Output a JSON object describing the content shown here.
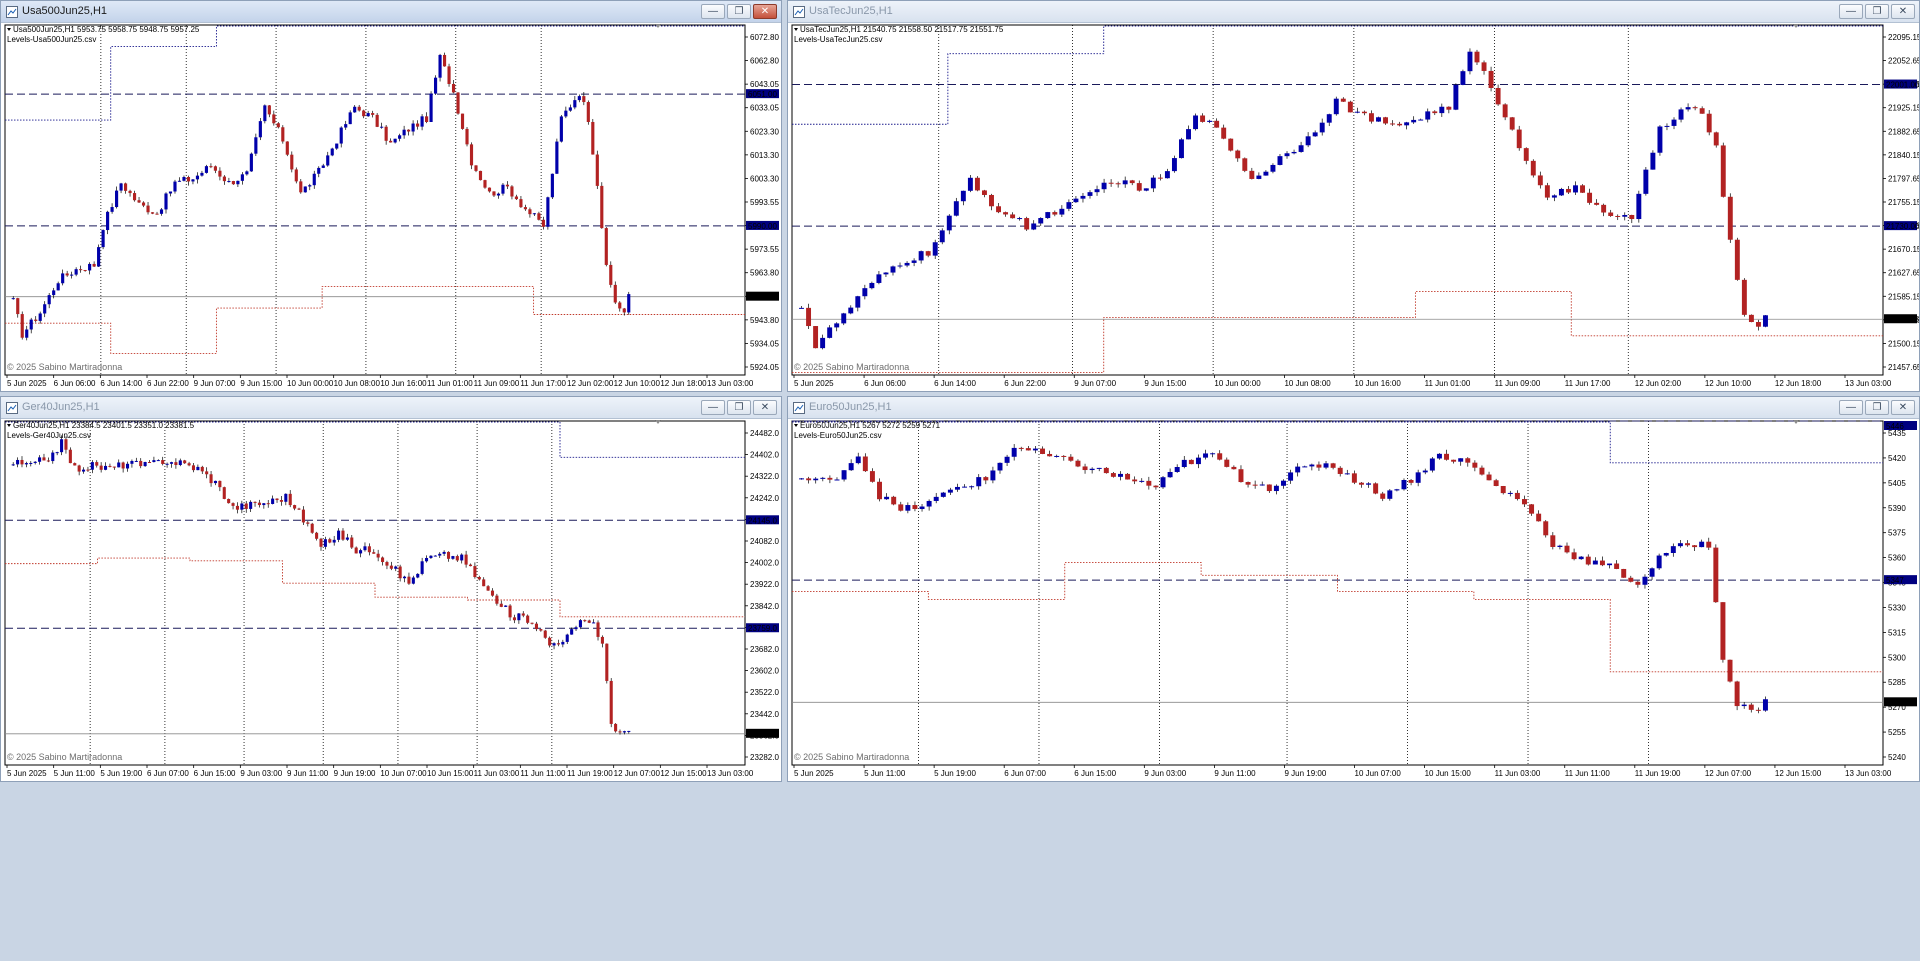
{
  "colors": {
    "bull": "#0000aa",
    "bear": "#b22222",
    "level_line": "#1a1a5a",
    "upper_band": "#1a1a8c",
    "lower_band": "#c0392b",
    "price_tag_bg": "#000000",
    "level_tag_bg": "#000080",
    "grid": "#000000"
  },
  "windows": [
    {
      "id": "us500",
      "active": true,
      "title": "Usa500Jun25,H1",
      "info_line": "Usa500Jun25,H1  5953.75 5958.75 5948.75 5957.25",
      "indicator": "Levels-Usa500Jun25.csv",
      "copyright": "© 2025 Sabino Martiradonna",
      "buttons": {
        "minimize": "—",
        "restore": "❐",
        "close": "✕"
      }
    },
    {
      "id": "ustec",
      "active": false,
      "title": "UsaTecJun25,H1",
      "info_line": "UsaTecJun25,H1  21540.75 21558.50 21517.75 21551.75",
      "indicator": "Levels-UsaTecJun25.csv",
      "copyright": "© 2025 Sabino Martiradonna",
      "buttons": {
        "minimize": "—",
        "restore": "❐",
        "close": "✕"
      }
    },
    {
      "id": "ger40",
      "active": false,
      "title": "Ger40Jun25,H1",
      "info_line": "Ger40Jun25,H1  23384.5 23401.5 23351.0 23381.5",
      "indicator": "Levels-Ger40Jun25.csv",
      "copyright": "© 2025 Sabino Martiradonna",
      "buttons": {
        "minimize": "—",
        "restore": "❐",
        "close": "✕"
      }
    },
    {
      "id": "euro50",
      "active": false,
      "title": "Euro50Jun25,H1",
      "info_line": "Euro50Jun25,H1  5267 5272 5259 5271",
      "indicator": "Levels-Euro50Jun25.csv",
      "copyright": "© 2025 Sabino Martiradonna",
      "buttons": {
        "minimize": "—",
        "restore": "❐",
        "close": "✕"
      }
    }
  ],
  "chart_data": [
    {
      "type": "candlestick",
      "title": "Usa500Jun25,H1",
      "ylim": [
        5921,
        6083
      ],
      "y_ticks": [
        "6072.80",
        "6062.80",
        "6043.05",
        "6033.05",
        "6023.30",
        "6013.30",
        "6003.30",
        "5993.55",
        "5983.55",
        "5973.55",
        "5963.80",
        "5953.80",
        "5943.80",
        "5934.05",
        "5924.05"
      ],
      "x_ticks": [
        "5 Jun 2025",
        "6 Jun 06:00",
        "6 Jun 14:00",
        "6 Jun 22:00",
        "9 Jun 07:00",
        "9 Jun 15:00",
        "10 Jun 00:00",
        "10 Jun 08:00",
        "10 Jun 16:00",
        "11 Jun 01:00",
        "11 Jun 09:00",
        "11 Jun 17:00",
        "12 Jun 02:00",
        "12 Jun 10:00",
        "12 Jun 18:00",
        "13 Jun 03:00"
      ],
      "day_separators": [
        "6 Jun",
        "9 Jun",
        "10 Jun",
        "11 Jun",
        "12 Jun",
        "13 Jun"
      ],
      "level_lines": [
        6051.0,
        5990.0
      ],
      "level_labels": [
        "6051.00",
        "5990.00"
      ],
      "current_price": 5957.25,
      "current_label": "5957.25",
      "upper_band": [
        6039,
        6073,
        6085,
        6085,
        6085,
        6085,
        6085
      ],
      "lower_band": [
        5945,
        5931,
        5952,
        5962,
        5962,
        5949,
        5949
      ],
      "waypoints": [
        [
          0,
          5955
        ],
        [
          2,
          5940
        ],
        [
          6,
          5950
        ],
        [
          10,
          5965
        ],
        [
          14,
          5970
        ],
        [
          18,
          5972
        ],
        [
          20,
          5990
        ],
        [
          24,
          6010
        ],
        [
          28,
          6000
        ],
        [
          32,
          5996
        ],
        [
          36,
          6010
        ],
        [
          40,
          6012
        ],
        [
          44,
          6018
        ],
        [
          48,
          6010
        ],
        [
          52,
          6014
        ],
        [
          56,
          6045
        ],
        [
          60,
          6030
        ],
        [
          64,
          6005
        ],
        [
          68,
          6015
        ],
        [
          72,
          6030
        ],
        [
          76,
          6045
        ],
        [
          80,
          6040
        ],
        [
          84,
          6028
        ],
        [
          88,
          6035
        ],
        [
          92,
          6040
        ],
        [
          95,
          6068
        ],
        [
          98,
          6052
        ],
        [
          102,
          6020
        ],
        [
          106,
          6005
        ],
        [
          110,
          6008
        ],
        [
          114,
          5998
        ],
        [
          118,
          5990
        ],
        [
          122,
          6040
        ],
        [
          126,
          6052
        ],
        [
          128,
          6040
        ],
        [
          130,
          6010
        ],
        [
          132,
          5970
        ],
        [
          134,
          5955
        ],
        [
          136,
          5950
        ],
        [
          137,
          5957
        ]
      ]
    },
    {
      "type": "candlestick",
      "title": "UsaTecJun25,H1",
      "ylim": [
        21445,
        22115
      ],
      "y_ticks": [
        "22095.15",
        "22052.65",
        "21967.65",
        "21925.15",
        "21882.65",
        "21840.15",
        "21797.65",
        "21755.15",
        "21712.65",
        "21670.15",
        "21627.65",
        "21585.15",
        "21542.65",
        "21500.15",
        "21457.65"
      ],
      "x_ticks": [
        "5 Jun 2025",
        "6 Jun 06:00",
        "6 Jun 14:00",
        "6 Jun 22:00",
        "9 Jun 07:00",
        "9 Jun 15:00",
        "10 Jun 00:00",
        "10 Jun 08:00",
        "10 Jun 16:00",
        "11 Jun 01:00",
        "11 Jun 09:00",
        "11 Jun 17:00",
        "12 Jun 02:00",
        "12 Jun 10:00",
        "12 Jun 18:00",
        "13 Jun 03:00"
      ],
      "day_separators": [
        "6 Jun",
        "9 Jun",
        "10 Jun",
        "11 Jun",
        "12 Jun",
        "13 Jun"
      ],
      "level_lines": [
        22001.0,
        21730.0
      ],
      "level_labels": [
        "22001.00",
        "21730.00"
      ],
      "current_price": 21551.75,
      "current_label": "21551.75",
      "upper_band": [
        21925,
        22060,
        22120,
        22120,
        22120,
        22120,
        22120
      ],
      "lower_band": [
        21450,
        21450,
        21555,
        21555,
        21605,
        21520,
        21520
      ],
      "waypoints": [
        [
          0,
          21580
        ],
        [
          2,
          21500
        ],
        [
          6,
          21560
        ],
        [
          10,
          21620
        ],
        [
          14,
          21660
        ],
        [
          18,
          21680
        ],
        [
          20,
          21720
        ],
        [
          24,
          21820
        ],
        [
          28,
          21760
        ],
        [
          32,
          21730
        ],
        [
          36,
          21760
        ],
        [
          40,
          21780
        ],
        [
          44,
          21820
        ],
        [
          48,
          21800
        ],
        [
          52,
          21830
        ],
        [
          56,
          21950
        ],
        [
          60,
          21900
        ],
        [
          64,
          21820
        ],
        [
          68,
          21860
        ],
        [
          72,
          21900
        ],
        [
          76,
          21970
        ],
        [
          80,
          21940
        ],
        [
          84,
          21920
        ],
        [
          88,
          21940
        ],
        [
          92,
          21960
        ],
        [
          95,
          22060
        ],
        [
          98,
          22000
        ],
        [
          102,
          21880
        ],
        [
          106,
          21790
        ],
        [
          110,
          21800
        ],
        [
          114,
          21760
        ],
        [
          118,
          21740
        ],
        [
          122,
          21920
        ],
        [
          126,
          21960
        ],
        [
          128,
          21940
        ],
        [
          130,
          21880
        ],
        [
          132,
          21700
        ],
        [
          134,
          21560
        ],
        [
          136,
          21530
        ],
        [
          137,
          21552
        ]
      ]
    },
    {
      "type": "candlestick",
      "title": "Ger40Jun25,H1",
      "ylim": [
        23270,
        24500
      ],
      "y_ticks": [
        "24482.0",
        "24402.0",
        "24322.0",
        "24242.0",
        "24162.0",
        "24082.0",
        "24002.0",
        "23922.0",
        "23842.0",
        "23762.0",
        "23682.0",
        "23602.0",
        "23522.0",
        "23442.0",
        "23362.0",
        "23282.0"
      ],
      "x_ticks": [
        "5 Jun 2025",
        "5 Jun 11:00",
        "5 Jun 19:00",
        "6 Jun 07:00",
        "6 Jun 15:00",
        "9 Jun 03:00",
        "9 Jun 11:00",
        "9 Jun 19:00",
        "10 Jun 07:00",
        "10 Jun 15:00",
        "11 Jun 03:00",
        "11 Jun 11:00",
        "11 Jun 19:00",
        "12 Jun 07:00",
        "12 Jun 15:00",
        "13 Jun 03:00"
      ],
      "day_separators": [
        "5 Jun",
        "6 Jun",
        "9 Jun",
        "10 Jun",
        "11 Jun",
        "12 Jun",
        "13 Jun"
      ],
      "level_lines": [
        24145.0,
        23759.0
      ],
      "level_labels": [
        "24145.0",
        "23759.0"
      ],
      "current_price": 23381.5,
      "current_label": "23381.5",
      "upper_band": [
        24620,
        24620,
        24620,
        24620,
        24620,
        24620,
        24370,
        24370
      ],
      "lower_band": [
        23990,
        24010,
        24000,
        23920,
        23870,
        23860,
        23800,
        23800
      ],
      "waypoints": [
        [
          0,
          24350
        ],
        [
          4,
          24340
        ],
        [
          8,
          24370
        ],
        [
          11,
          24420
        ],
        [
          14,
          24330
        ],
        [
          18,
          24340
        ],
        [
          22,
          24330
        ],
        [
          26,
          24350
        ],
        [
          30,
          24340
        ],
        [
          34,
          24360
        ],
        [
          38,
          24350
        ],
        [
          42,
          24330
        ],
        [
          46,
          24280
        ],
        [
          50,
          24190
        ],
        [
          54,
          24200
        ],
        [
          58,
          24210
        ],
        [
          62,
          24230
        ],
        [
          66,
          24150
        ],
        [
          70,
          24050
        ],
        [
          74,
          24100
        ],
        [
          78,
          24040
        ],
        [
          82,
          24040
        ],
        [
          86,
          23980
        ],
        [
          90,
          23920
        ],
        [
          94,
          24010
        ],
        [
          98,
          24020
        ],
        [
          102,
          24010
        ],
        [
          106,
          23930
        ],
        [
          110,
          23850
        ],
        [
          114,
          23800
        ],
        [
          118,
          23790
        ],
        [
          122,
          23700
        ],
        [
          126,
          23730
        ],
        [
          130,
          23790
        ],
        [
          132,
          23780
        ],
        [
          134,
          23700
        ],
        [
          136,
          23420
        ],
        [
          138,
          23390
        ],
        [
          140,
          23380
        ]
      ]
    },
    {
      "type": "candlestick",
      "title": "Euro50Jun25,H1",
      "ylim": [
        5232,
        5446
      ],
      "y_ticks": [
        "5435",
        "5420",
        "5405",
        "5390",
        "5375",
        "5360",
        "5345",
        "5330",
        "5315",
        "5300",
        "5285",
        "5270",
        "5255",
        "5240"
      ],
      "x_ticks": [
        "5 Jun 2025",
        "5 Jun 11:00",
        "5 Jun 19:00",
        "6 Jun 07:00",
        "6 Jun 15:00",
        "9 Jun 03:00",
        "9 Jun 11:00",
        "9 Jun 19:00",
        "10 Jun 07:00",
        "10 Jun 15:00",
        "11 Jun 03:00",
        "11 Jun 11:00",
        "11 Jun 19:00",
        "12 Jun 07:00",
        "12 Jun 15:00",
        "13 Jun 03:00"
      ],
      "day_separators": [
        "5 Jun",
        "6 Jun",
        "9 Jun",
        "10 Jun",
        "11 Jun",
        "12 Jun",
        "13 Jun"
      ],
      "level_lines": [
        5446.0,
        5347.0
      ],
      "level_labels": [
        "5446",
        "5347"
      ],
      "current_price": 5271,
      "current_label": "5271",
      "upper_band": [
        5500,
        5500,
        5500,
        5500,
        5500,
        5500,
        5420,
        5420
      ],
      "lower_band": [
        5340,
        5335,
        5358,
        5350,
        5340,
        5335,
        5290,
        5290
      ],
      "waypoints": [
        [
          0,
          5410
        ],
        [
          4,
          5408
        ],
        [
          8,
          5425
        ],
        [
          11,
          5400
        ],
        [
          14,
          5390
        ],
        [
          18,
          5395
        ],
        [
          22,
          5405
        ],
        [
          26,
          5410
        ],
        [
          30,
          5430
        ],
        [
          34,
          5425
        ],
        [
          38,
          5420
        ],
        [
          42,
          5415
        ],
        [
          46,
          5410
        ],
        [
          50,
          5405
        ],
        [
          54,
          5420
        ],
        [
          58,
          5425
        ],
        [
          62,
          5410
        ],
        [
          66,
          5405
        ],
        [
          70,
          5415
        ],
        [
          74,
          5420
        ],
        [
          78,
          5410
        ],
        [
          82,
          5400
        ],
        [
          86,
          5410
        ],
        [
          90,
          5425
        ],
        [
          94,
          5420
        ],
        [
          98,
          5405
        ],
        [
          102,
          5395
        ],
        [
          106,
          5370
        ],
        [
          110,
          5360
        ],
        [
          114,
          5355
        ],
        [
          118,
          5345
        ],
        [
          122,
          5365
        ],
        [
          126,
          5370
        ],
        [
          128,
          5368
        ],
        [
          130,
          5300
        ],
        [
          132,
          5270
        ],
        [
          134,
          5265
        ],
        [
          136,
          5271
        ]
      ]
    }
  ]
}
